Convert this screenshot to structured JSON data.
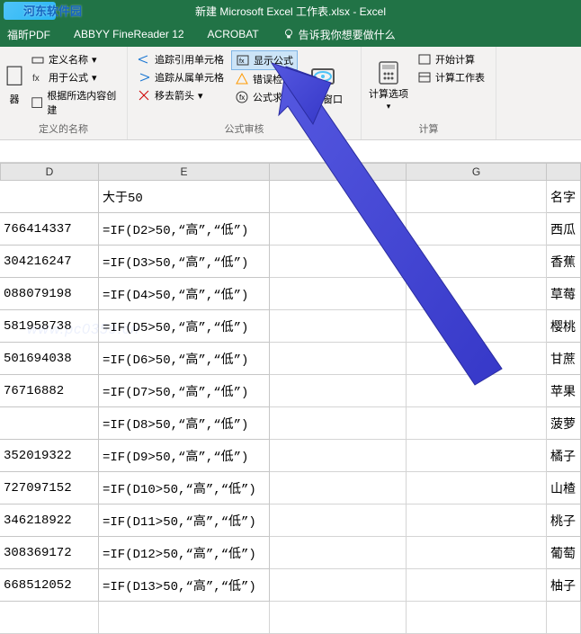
{
  "title": "新建 Microsoft Excel 工作表.xlsx - Excel",
  "watermark_name": "河东软件园",
  "watermark_url": "www.pc0359.cn",
  "tabs": {
    "pdf": "福昕PDF",
    "abbyy": "ABBYY FineReader 12",
    "acrobat": "ACROBAT",
    "tellme": "告诉我你想要做什么"
  },
  "ribbon": {
    "group1": {
      "label": "定义的名称",
      "mgr": "器",
      "btn1": "定义名称",
      "btn2": "用于公式",
      "btn3": "根据所选内容创建"
    },
    "group2": {
      "label": "公式审核",
      "trace_prec": "追踪引用单元格",
      "trace_dep": "追踪从属单元格",
      "remove_arrows": "移去箭头",
      "show_formulas": "显示公式",
      "error_check": "错误检查",
      "eval_formula": "公式求值",
      "watch_window": "监视窗口"
    },
    "group3": {
      "label": "计算",
      "calc_options": "计算选项",
      "calc_now": "开始计算",
      "calc_sheet": "计算工作表"
    }
  },
  "columns": {
    "D": "D",
    "E": "E",
    "F": "F",
    "G": "G"
  },
  "headers": {
    "E": "大于50",
    "H": "名字"
  },
  "chart_data": {
    "type": "table",
    "rows": [
      {
        "D": "766414337",
        "E": "=IF(D2>50,\"高\",\"低\")",
        "H": "西瓜"
      },
      {
        "D": "304216247",
        "E": "=IF(D3>50,\"高\",\"低\")",
        "H": "香蕉"
      },
      {
        "D": "088079198",
        "E": "=IF(D4>50,\"高\",\"低\")",
        "H": "草莓"
      },
      {
        "D": "581958738",
        "E": "=IF(D5>50,\"高\",\"低\")",
        "H": "樱桃"
      },
      {
        "D": "501694038",
        "E": "=IF(D6>50,\"高\",\"低\")",
        "H": "甘蔗"
      },
      {
        "D": "76716882",
        "E": "=IF(D7>50,\"高\",\"低\")",
        "H": "苹果"
      },
      {
        "D": "",
        "E": "=IF(D8>50,\"高\",\"低\")",
        "H": "菠萝"
      },
      {
        "D": "352019322",
        "E": "=IF(D9>50,\"高\",\"低\")",
        "H": "橘子"
      },
      {
        "D": "727097152",
        "E": "=IF(D10>50,\"高\",\"低\")",
        "H": "山楂"
      },
      {
        "D": "346218922",
        "E": "=IF(D11>50,\"高\",\"低\")",
        "H": "桃子"
      },
      {
        "D": "308369172",
        "E": "=IF(D12>50,\"高\",\"低\")",
        "H": "葡萄"
      },
      {
        "D": "668512052",
        "E": "=IF(D13>50,\"高\",\"低\")",
        "H": "柚子"
      }
    ]
  }
}
